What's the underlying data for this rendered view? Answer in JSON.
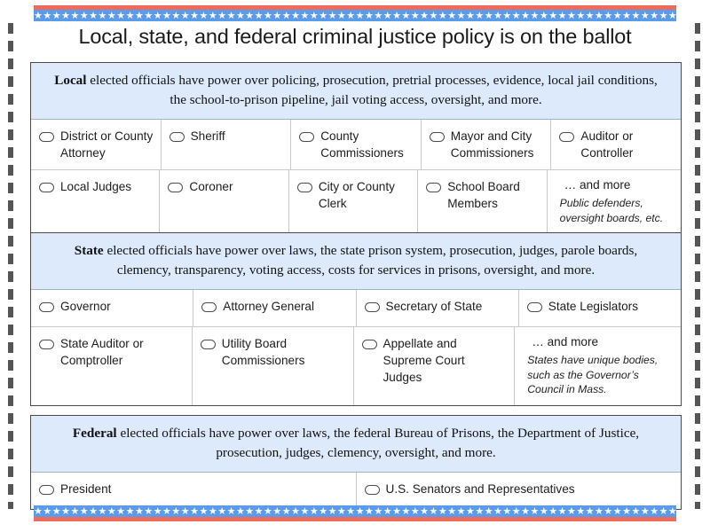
{
  "page": {
    "title": "Local, state, and federal criminal justice policy is on the ballot",
    "accent_blue": "#5a9bea",
    "accent_red": "#ee6b5b",
    "header_band_blue": "#ddeafb",
    "stars": "★★★★★★★★★★★★★★★★★★★★★★★★★★★★★★★★★★★★★★★★★★★★★★★★★★★★★★★★★★★★★★★★★★★★★★★★★★★★★★★★★★★★★★★★★★★★★★★★★"
  },
  "sections": {
    "local": {
      "level": "Local",
      "header_rest": " elected officials have power over policing, prosecution, pretrial processes, evidence, local jail conditions, the school-to-prison pipeline, jail voting access, oversight, and more.",
      "rows": [
        [
          "District or County Attorney",
          "Sheriff",
          "County Commissioners",
          "Mayor and City Commissioners",
          "Auditor or Controller"
        ],
        [
          "Local Judges",
          "Coroner",
          "City or County Clerk",
          "School Board Members"
        ]
      ],
      "more_title": "… and more",
      "more_note": "Public defenders, oversight boards, etc."
    },
    "state": {
      "level": "State",
      "header_rest": " elected officials have power over laws, the state prison system, prosecution, judges, parole boards, clemency, transparency, voting access, costs for services in prisons, oversight, and more.",
      "rows": [
        [
          "Governor",
          "Attorney General",
          "Secretary of State",
          "State Legislators"
        ],
        [
          "State Auditor or Comptroller",
          "Utility Board Commissioners",
          "Appellate and Supreme Court Judges"
        ]
      ],
      "more_title": "… and more",
      "more_note": "States have unique bodies, such as the Governor’s Council in Mass."
    },
    "federal": {
      "level": "Federal",
      "header_rest": " elected officials have power over laws, the federal Bureau of Prisons, the Department of Justice, prosecution, judges, clemency, oversight, and more.",
      "rows": [
        [
          "President",
          "U.S. Senators and Representatives"
        ]
      ]
    }
  }
}
